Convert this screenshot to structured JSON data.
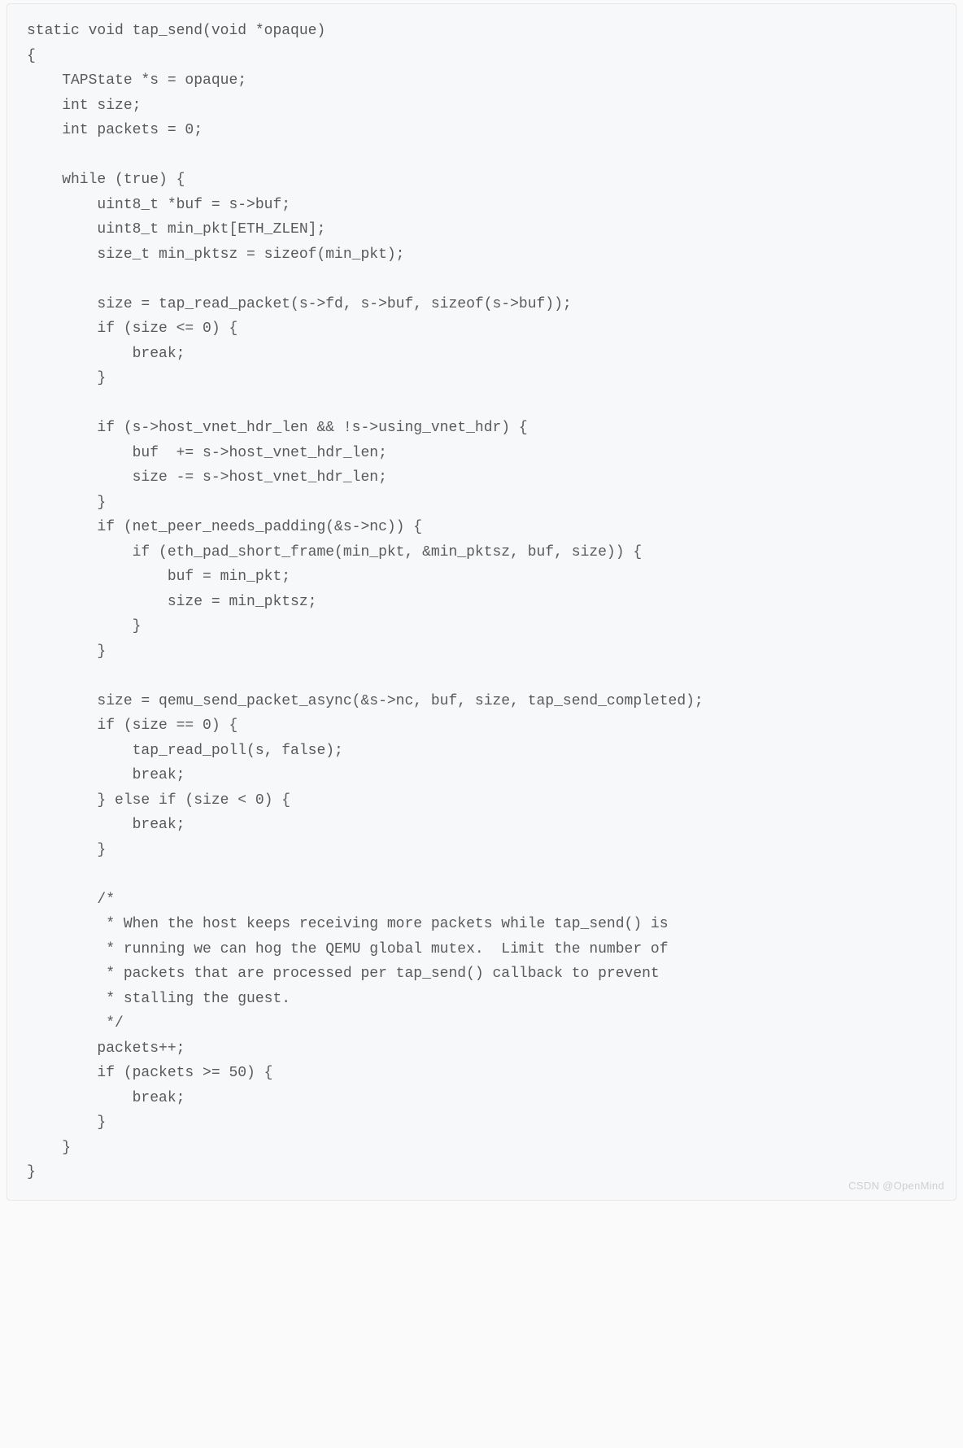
{
  "code": {
    "lines": [
      "static void tap_send(void *opaque)",
      "{",
      "    TAPState *s = opaque;",
      "    int size;",
      "    int packets = 0;",
      "",
      "    while (true) {",
      "        uint8_t *buf = s->buf;",
      "        uint8_t min_pkt[ETH_ZLEN];",
      "        size_t min_pktsz = sizeof(min_pkt);",
      "",
      "        size = tap_read_packet(s->fd, s->buf, sizeof(s->buf));",
      "        if (size <= 0) {",
      "            break;",
      "        }",
      "",
      "        if (s->host_vnet_hdr_len && !s->using_vnet_hdr) {",
      "            buf  += s->host_vnet_hdr_len;",
      "            size -= s->host_vnet_hdr_len;",
      "        }",
      "        if (net_peer_needs_padding(&s->nc)) {",
      "            if (eth_pad_short_frame(min_pkt, &min_pktsz, buf, size)) {",
      "                buf = min_pkt;",
      "                size = min_pktsz;",
      "            }",
      "        }",
      "",
      "        size = qemu_send_packet_async(&s->nc, buf, size, tap_send_completed);",
      "        if (size == 0) {",
      "            tap_read_poll(s, false);",
      "            break;",
      "        } else if (size < 0) {",
      "            break;",
      "        }",
      "",
      "        /*",
      "         * When the host keeps receiving more packets while tap_send() is",
      "         * running we can hog the QEMU global mutex.  Limit the number of",
      "         * packets that are processed per tap_send() callback to prevent",
      "         * stalling the guest.",
      "         */",
      "        packets++;",
      "        if (packets >= 50) {",
      "            break;",
      "        }",
      "    }",
      "}"
    ]
  },
  "watermark": "CSDN @OpenMind"
}
